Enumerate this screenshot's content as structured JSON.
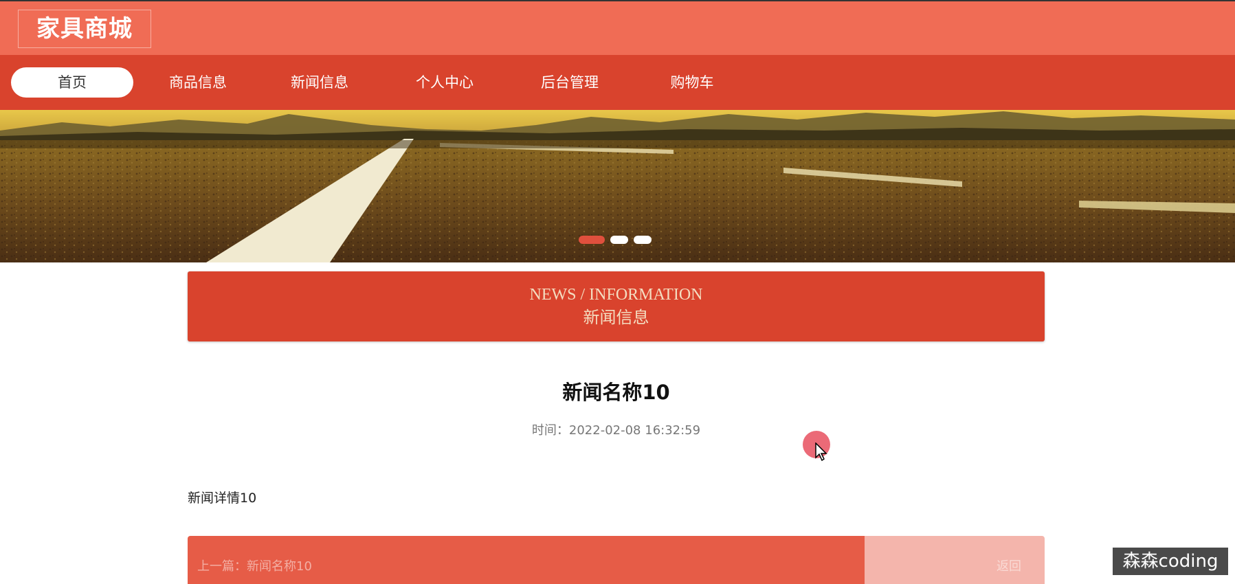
{
  "header": {
    "site_title": "家具商城"
  },
  "nav": {
    "items": [
      {
        "label": "首页",
        "active": true
      },
      {
        "label": "商品信息",
        "active": false
      },
      {
        "label": "新闻信息",
        "active": false
      },
      {
        "label": "个人中心",
        "active": false
      },
      {
        "label": "后台管理",
        "active": false
      },
      {
        "label": "购物车",
        "active": false
      }
    ]
  },
  "banner": {
    "slide_count": 3,
    "active_slide": 1
  },
  "section": {
    "title_en": "NEWS / INFORMATION",
    "title_cn": "新闻信息"
  },
  "article": {
    "title": "新闻名称10",
    "time_label": "时间：",
    "time_value": "2022-02-08 16:32:59",
    "detail": "新闻详情10"
  },
  "footer_nav": {
    "next_label": "上一篇：新闻名称10",
    "back_label": "返回"
  },
  "watermark": {
    "text": "森森coding"
  },
  "colors": {
    "header_bg": "#f06c55",
    "nav_bg": "#d9432d",
    "section_bg": "#d9432d",
    "section_text": "#f4dcc0"
  }
}
